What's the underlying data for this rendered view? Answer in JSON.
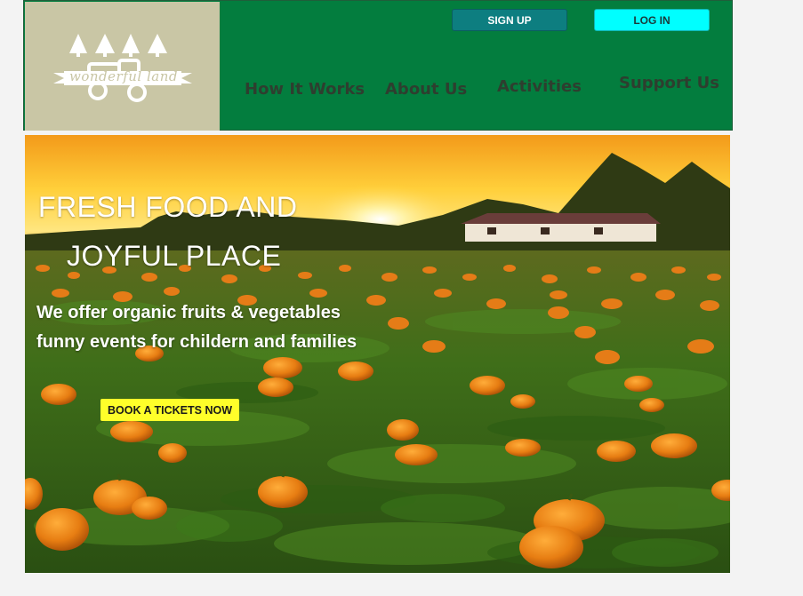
{
  "brand": {
    "logo_text": "wonderful land",
    "logo_bg": "#c9c6a5"
  },
  "header": {
    "bg": "#037d3e",
    "signup_label": "SIGN UP",
    "login_label": "LOG IN",
    "nav": [
      {
        "label": "How It Works"
      },
      {
        "label": "About Us"
      },
      {
        "label": "Activities"
      },
      {
        "label": "Support Us"
      }
    ]
  },
  "hero": {
    "title_line1": "FRESH FOOD AND",
    "title_line2": "JOYFUL PLACE",
    "subtitle_line1": "We offer organic fruits & vegetables",
    "subtitle_line2": "funny events for childern and families",
    "cta_label": "BOOK A TICKETS NOW",
    "cta_color": "#ffff2a"
  }
}
